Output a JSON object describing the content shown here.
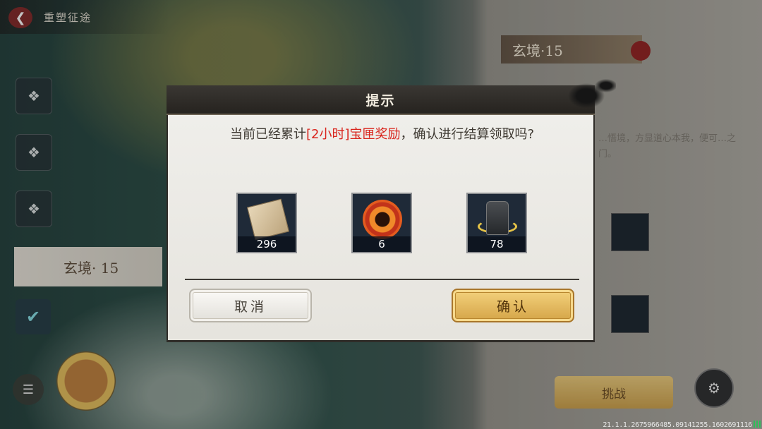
{
  "topbar": {
    "title": "重塑征途"
  },
  "stages": {
    "left_label": "玄境· 15",
    "right_label": "玄境·15"
  },
  "right_panel": {
    "desc": "…悟境，方显道心本我，便可…之门。",
    "challenge_label": "挑战"
  },
  "dialog": {
    "title": "提示",
    "message_prefix": "当前已经累计",
    "message_highlight": "[2小时]宝匣奖励",
    "message_suffix": "，确认进行结算领取吗?",
    "rewards": [
      {
        "icon": "scroll-paper-icon",
        "count": "296"
      },
      {
        "icon": "fire-orb-icon",
        "count": "6"
      },
      {
        "icon": "stone-tablet-icon",
        "count": "78"
      }
    ],
    "cancel_label": "取消",
    "confirm_label": "确认"
  },
  "debug": "21.1.1.2675966485.09141255.1602691116",
  "colors": {
    "highlight": "#d9241c",
    "confirm_gold": "#e2b85e",
    "header_dark": "#2c2925"
  }
}
